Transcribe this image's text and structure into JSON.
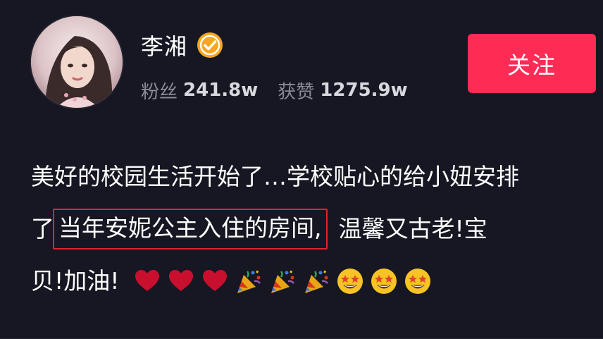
{
  "profile": {
    "name": "李湘",
    "verified": true,
    "fans_label": "粉丝",
    "fans_value": "241.8w",
    "likes_label": "获赞",
    "likes_value": "1275.9w"
  },
  "follow_button": {
    "label": "关注",
    "color": "#fe2c55"
  },
  "post": {
    "line1": "美好的校园生活开始了…学校贴心的给小妞安排",
    "line2_prefix": "了",
    "line2_highlight": "当年安妮公主入住的房间,",
    "line2_suffix": "温馨又古老!宝",
    "line3": "贝!加油!",
    "emojis": [
      "red-heart",
      "red-heart",
      "red-heart",
      "party-popper",
      "party-popper",
      "party-popper",
      "star-struck",
      "star-struck",
      "star-struck"
    ]
  },
  "colors": {
    "background": "#161722",
    "highlight_border": "#e0242c",
    "verified_badge": "#f6a623"
  }
}
